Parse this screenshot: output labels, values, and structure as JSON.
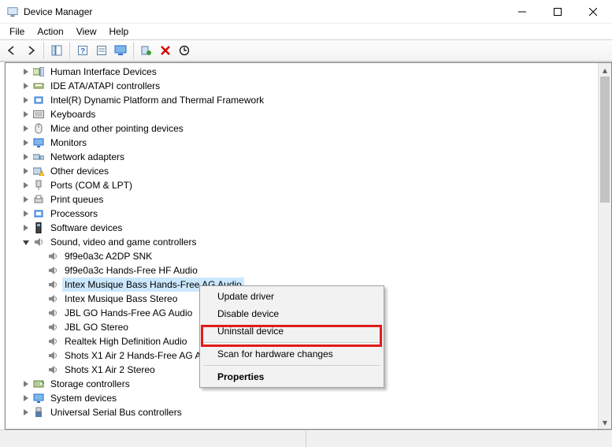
{
  "window": {
    "title": "Device Manager"
  },
  "menu": {
    "items": [
      "File",
      "Action",
      "View",
      "Help"
    ]
  },
  "toolbar_icons": [
    "back",
    "forward",
    "|",
    "show-hide",
    "|",
    "help",
    "properties",
    "pc",
    "|",
    "scan",
    "delete",
    "update"
  ],
  "tree": {
    "expanded_category": "Sound, video and game controllers",
    "selected_child": "Intex Musique Bass Hands-Free AG Audio",
    "top_categories": [
      "Human Interface Devices",
      "IDE ATA/ATAPI controllers",
      "Intel(R) Dynamic Platform and Thermal Framework",
      "Keyboards",
      "Mice and other pointing devices",
      "Monitors",
      "Network adapters",
      "Other devices",
      "Ports (COM & LPT)",
      "Print queues",
      "Processors",
      "Software devices"
    ],
    "sound_children": [
      "9f9e0a3c A2DP SNK",
      "9f9e0a3c Hands-Free HF Audio",
      "Intex Musique Bass Hands-Free AG Audio",
      "Intex Musique Bass Stereo",
      "JBL GO Hands-Free AG Audio",
      "JBL GO Stereo",
      "Realtek High Definition Audio",
      "Shots X1 Air 2 Hands-Free AG Audio",
      "Shots X1 Air 2 Stereo"
    ],
    "bottom_categories": [
      "Storage controllers",
      "System devices",
      "Universal Serial Bus controllers"
    ]
  },
  "context_menu": {
    "items": [
      {
        "label": "Update driver"
      },
      {
        "label": "Disable device"
      },
      {
        "label": "Uninstall device",
        "highlighted": true
      },
      {
        "sep": true
      },
      {
        "label": "Scan for hardware changes"
      },
      {
        "sep": true
      },
      {
        "label": "Properties",
        "bold": true
      }
    ]
  }
}
